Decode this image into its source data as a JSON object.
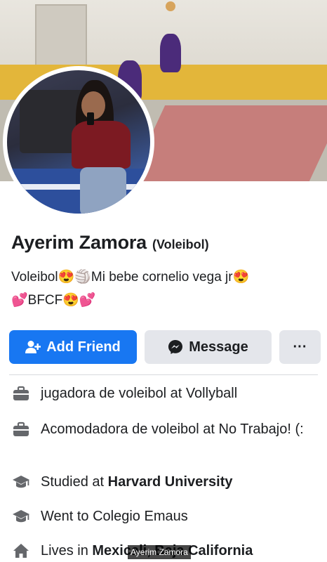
{
  "profile": {
    "name": "Ayerim Zamora",
    "alternate_name": "(Voleibol)",
    "bio_line1": "Voleibol😍🏐Mi bebe cornelio vega jr😍",
    "bio_line2": "💕BFCF😍💕"
  },
  "actions": {
    "add_friend": "Add Friend",
    "message": "Message",
    "more": "···"
  },
  "details": [
    {
      "icon": "briefcase-icon",
      "text": "jugadora de voleibol at Vollyball"
    },
    {
      "icon": "briefcase-icon",
      "text": "Acomodadora de voleibol at No Trabajo! (:"
    },
    {
      "icon": "graduation-cap-icon",
      "prefix": "Studied at ",
      "bold": "Harvard University"
    },
    {
      "icon": "graduation-cap-icon",
      "text": "Went to Colegio Emaus"
    },
    {
      "icon": "home-icon",
      "prefix": "Lives in ",
      "bold": "Mexicali, Baja California"
    }
  ],
  "watermark": "Ayerim Zamora",
  "colors": {
    "primary": "#1877f2",
    "secondary_button": "#e4e6eb",
    "text": "#1c1e21"
  }
}
